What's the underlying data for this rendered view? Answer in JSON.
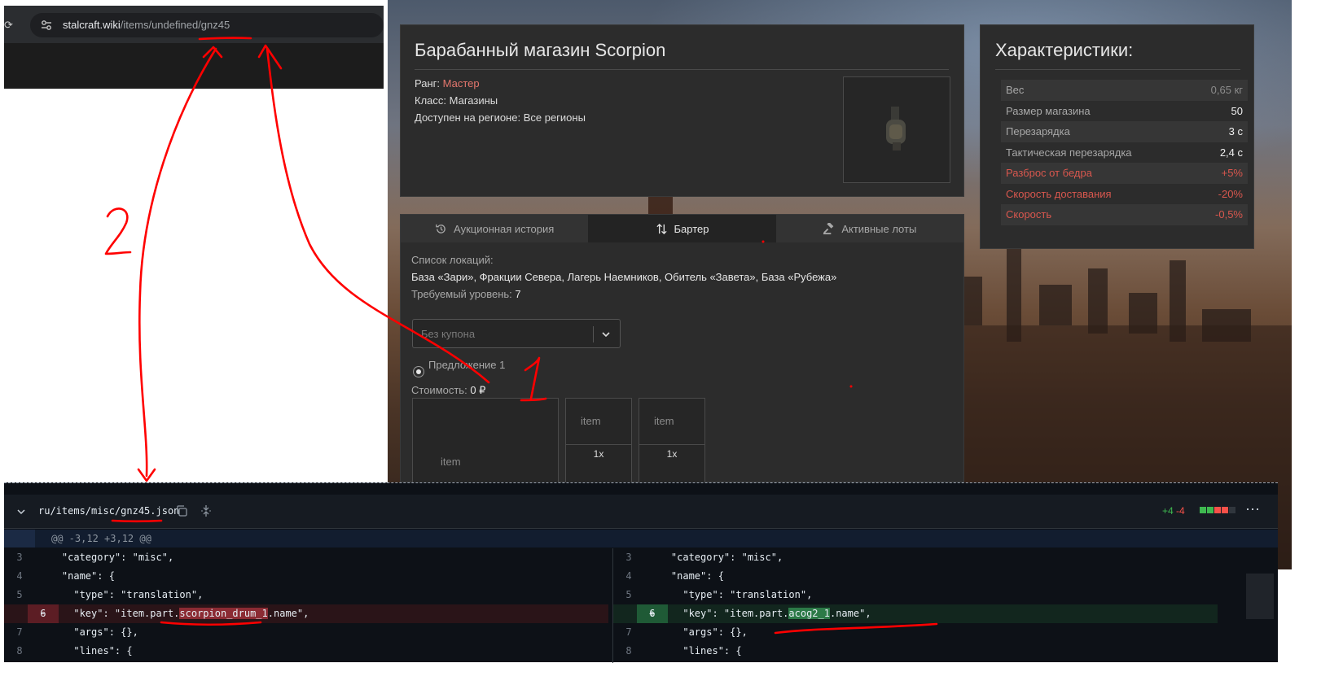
{
  "browser": {
    "url_host": "stalcraft.wiki",
    "url_path": "/items/undefined/gnz45"
  },
  "item": {
    "title": "Барабанный магазин Scorpion",
    "rank_label": "Ранг:",
    "rank_value": "Мастер",
    "class_label": "Класс:",
    "class_value": "Магазины",
    "region_label": "Доступен на регионе:",
    "region_value": "Все регионы"
  },
  "stats": {
    "title": "Характеристики:",
    "rows": [
      {
        "key": "Вес",
        "value": "0,65 кг"
      },
      {
        "key": "Размер магазина",
        "value": "50"
      },
      {
        "key": "Перезарядка",
        "value": "3 с"
      },
      {
        "key": "Тактическая перезарядка",
        "value": "2,4 с"
      },
      {
        "key": "Разброс от бедра",
        "value": "+5%"
      },
      {
        "key": "Скорость доставания",
        "value": "-20%"
      },
      {
        "key": "Скорость",
        "value": "-0,5%"
      }
    ]
  },
  "tabs": [
    {
      "label": "Аукционная история"
    },
    {
      "label": "Бартер"
    },
    {
      "label": "Активные лоты"
    }
  ],
  "barter": {
    "locations_label": "Список локаций:",
    "locations_value": "База «Зари», Фракции Севера, Лагерь Наемников, Обитель «Завета», База «Рубежа»",
    "level_label": "Требуемый уровень:",
    "level_value": "7",
    "coupon_placeholder": "Без купона",
    "offer_label": "Предложение 1",
    "cost_label": "Стоимость:",
    "cost_value": "0 ₽",
    "slot_alt": "item",
    "slot_qty": "1x"
  },
  "diff": {
    "file_path_prefix": "ru/items/misc/",
    "file_path_name": "gnz45.json",
    "additions": "+4",
    "deletions": "-4",
    "hunk": "@@ -3,12 +3,12 @@",
    "left": [
      {
        "n": "3",
        "code": "    \"category\": \"misc\","
      },
      {
        "n": "4",
        "code": "    \"name\": {"
      },
      {
        "n": "5",
        "code": "      \"type\": \"translation\","
      },
      {
        "n": "6",
        "sign": "-",
        "pre": "      \"key\": \"item.part.",
        "hl": "scorpion_drum_1",
        "post": ".name\","
      },
      {
        "n": "7",
        "code": "      \"args\": {},"
      },
      {
        "n": "8",
        "code": "      \"lines\": {"
      }
    ],
    "right": [
      {
        "n": "3",
        "code": "    \"category\": \"misc\","
      },
      {
        "n": "4",
        "code": "    \"name\": {"
      },
      {
        "n": "5",
        "code": "      \"type\": \"translation\","
      },
      {
        "n": "6",
        "sign": "+",
        "pre": "      \"key\": \"item.part.",
        "hl": "acog2_1",
        "post": ".name\","
      },
      {
        "n": "7",
        "code": "      \"args\": {},"
      },
      {
        "n": "8",
        "code": "      \"lines\": {"
      }
    ]
  },
  "annotations": {
    "label_1": "1",
    "label_2": "2"
  },
  "colors": {
    "rank": "#e4766d",
    "negative_stat": "#d8574e",
    "annotation": "#ff0000"
  }
}
